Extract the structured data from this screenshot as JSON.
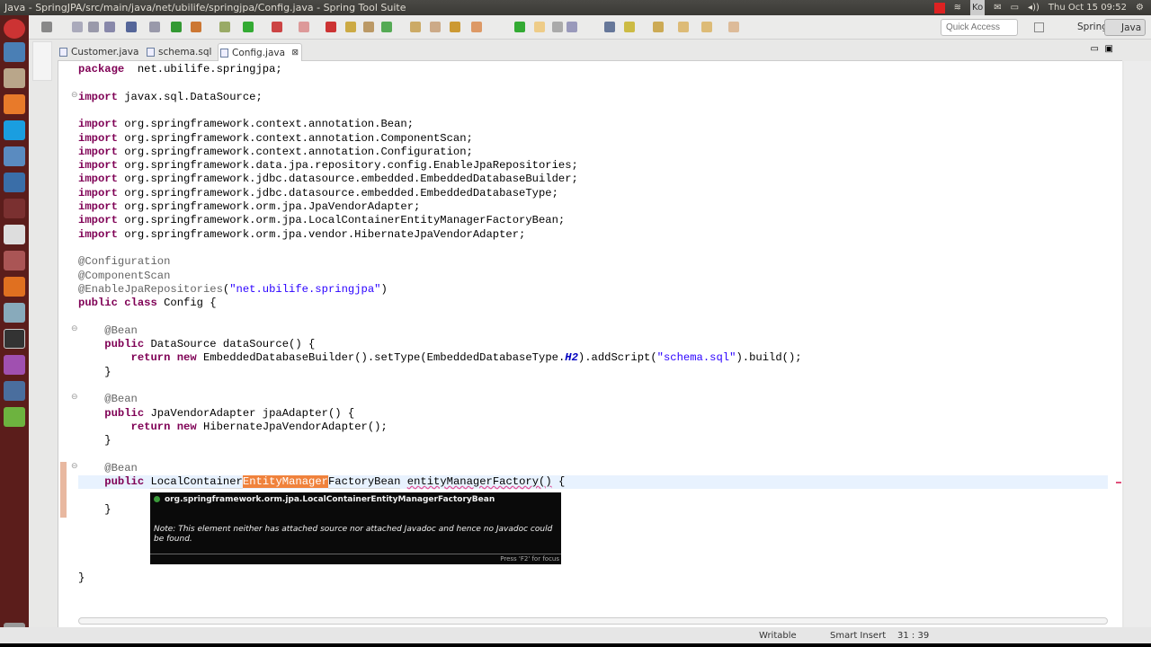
{
  "window": {
    "title": "Java - SpringJPA/src/main/java/net/ubilife/springjpa/Config.java - Spring Tool Suite"
  },
  "tray": {
    "keyboard": "Ko",
    "clock": "Thu Oct 15 09:52"
  },
  "toolbar": {
    "quick_access_placeholder": "Quick Access",
    "perspectives": [
      {
        "label": "Spring",
        "active": false
      },
      {
        "label": "Java",
        "active": true
      }
    ]
  },
  "tabs": [
    {
      "label": "Customer.java",
      "active": false
    },
    {
      "label": "schema.sql",
      "active": false
    },
    {
      "label": "Config.java",
      "active": true,
      "close": "⊠"
    }
  ],
  "editor": {
    "lines": [
      [
        [
          "kw",
          "package"
        ],
        [
          "",
          "  net.ubilife.springjpa;"
        ]
      ],
      [],
      [
        [
          "kw",
          "import"
        ],
        [
          "",
          " javax.sql.DataSource;"
        ]
      ],
      [],
      [
        [
          "kw",
          "import"
        ],
        [
          "",
          " org.springframework.context.annotation.Bean;"
        ]
      ],
      [
        [
          "kw",
          "import"
        ],
        [
          "",
          " org.springframework.context.annotation.ComponentScan;"
        ]
      ],
      [
        [
          "kw",
          "import"
        ],
        [
          "",
          " org.springframework.context.annotation.Configuration;"
        ]
      ],
      [
        [
          "kw",
          "import"
        ],
        [
          "",
          " org.springframework.data.jpa.repository.config.EnableJpaRepositories;"
        ]
      ],
      [
        [
          "kw",
          "import"
        ],
        [
          "",
          " org.springframework.jdbc.datasource.embedded.EmbeddedDatabaseBuilder;"
        ]
      ],
      [
        [
          "kw",
          "import"
        ],
        [
          "",
          " org.springframework.jdbc.datasource.embedded.EmbeddedDatabaseType;"
        ]
      ],
      [
        [
          "kw",
          "import"
        ],
        [
          "",
          " org.springframework.orm.jpa.JpaVendorAdapter;"
        ]
      ],
      [
        [
          "kw",
          "import"
        ],
        [
          "",
          " org.springframework.orm.jpa.LocalContainerEntityManagerFactoryBean;"
        ]
      ],
      [
        [
          "kw",
          "import"
        ],
        [
          "",
          " org.springframework.orm.jpa.vendor.HibernateJpaVendorAdapter;"
        ]
      ],
      [],
      [
        [
          "ann",
          "@Configuration"
        ]
      ],
      [
        [
          "ann",
          "@ComponentScan"
        ]
      ],
      [
        [
          "ann",
          "@EnableJpaRepositories"
        ],
        [
          "",
          "("
        ],
        [
          "str",
          "\"net.ubilife.springjpa\""
        ],
        [
          "",
          ")"
        ]
      ],
      [
        [
          "kw",
          "public"
        ],
        [
          "",
          " "
        ],
        [
          "kw",
          "class"
        ],
        [
          "",
          " Config {"
        ]
      ],
      [],
      [
        [
          "",
          "    "
        ],
        [
          "ann",
          "@Bean"
        ]
      ],
      [
        [
          "",
          "    "
        ],
        [
          "kw",
          "public"
        ],
        [
          "",
          " DataSource dataSource() {"
        ]
      ],
      [
        [
          "",
          "        "
        ],
        [
          "kw",
          "return"
        ],
        [
          "",
          " "
        ],
        [
          "kw",
          "new"
        ],
        [
          "",
          " EmbeddedDatabaseBuilder().setType(EmbeddedDatabaseType."
        ],
        [
          "st",
          "H2"
        ],
        [
          "",
          ").addScript("
        ],
        [
          "str",
          "\"schema.sql\""
        ],
        [
          "",
          ").build();"
        ]
      ],
      [
        [
          "",
          "    }"
        ]
      ],
      [],
      [
        [
          "",
          "    "
        ],
        [
          "ann",
          "@Bean"
        ]
      ],
      [
        [
          "",
          "    "
        ],
        [
          "kw",
          "public"
        ],
        [
          "",
          " JpaVendorAdapter jpaAdapter() {"
        ]
      ],
      [
        [
          "",
          "        "
        ],
        [
          "kw",
          "return"
        ],
        [
          "",
          " "
        ],
        [
          "kw",
          "new"
        ],
        [
          "",
          " HibernateJpaVendorAdapter();"
        ]
      ],
      [
        [
          "",
          "    }"
        ]
      ],
      [],
      [
        [
          "",
          "    "
        ],
        [
          "ann",
          "@Bean"
        ]
      ],
      [
        [
          "",
          "    "
        ],
        [
          "kw",
          "public"
        ],
        [
          "",
          " "
        ],
        [
          "ul",
          "LocalContainer"
        ],
        [
          "hl",
          "EntityManager"
        ],
        [
          "ul",
          "FactoryBean"
        ],
        [
          "",
          " "
        ],
        [
          "sq",
          "entityManagerFactory()"
        ],
        [
          "",
          " {"
        ]
      ],
      [],
      [
        [
          "",
          "    }"
        ]
      ],
      [],
      [],
      [],
      [],
      [
        [
          "",
          "}"
        ]
      ]
    ],
    "fold_lines": [
      3,
      20,
      25,
      30
    ]
  },
  "tooltip": {
    "title": "org.springframework.orm.jpa.LocalContainerEntityManagerFactoryBean",
    "note": "Note: This element neither has attached source nor attached Javadoc and hence no Javadoc could be found.",
    "footer": "Press 'F2' for focus"
  },
  "status": {
    "mode": "Writable",
    "insert": "Smart Insert",
    "position": "31 : 39"
  },
  "colors": {
    "keyword": "#7f0055",
    "annotation": "#646464",
    "string": "#2a00ff",
    "highlight": "#f0823c",
    "launcher": "#5b1d1b"
  }
}
